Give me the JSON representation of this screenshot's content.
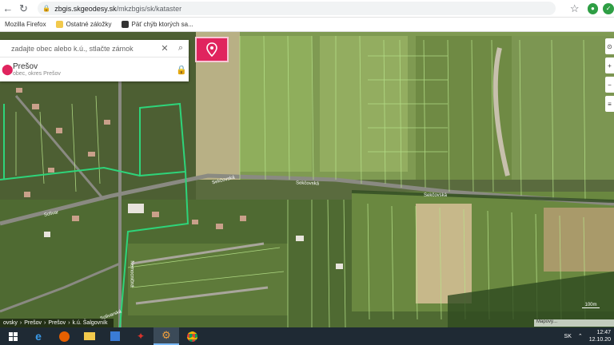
{
  "browser": {
    "back_icon": "arrow-left-icon",
    "refresh_icon": "refresh-icon",
    "url_domain": "zbgis.skgeodesy.sk",
    "url_path": "/mkzbgis/sk/kataster",
    "star_icon": "star-icon"
  },
  "bookmarks": [
    {
      "label": "Mozilla Firefox"
    },
    {
      "label": "Ostatné záložky"
    },
    {
      "label": "Päť chýb ktorých sa..."
    }
  ],
  "search": {
    "placeholder": "zadajte obec alebo k.ú., stlačte zámok"
  },
  "location": {
    "name": "Prešov",
    "subtitle": "obec, okres Prešov"
  },
  "breadcrumb": [
    "ovsky",
    "›",
    "Prešov",
    "›",
    "Prešov",
    "›",
    "k.ú. Šalgovník"
  ],
  "map_labels": {
    "street1": "Sekčovská",
    "street2": "Sekčovská",
    "street3": "Sekčovská",
    "street4": "Solivar",
    "street5": "Nemocničná",
    "street6": "Solivarská"
  },
  "scale": "100m",
  "map_attr": "Mapový...",
  "taskbar": {
    "lang": "SK",
    "time": "12:47",
    "date": "12.10.20"
  },
  "colors": {
    "pink": "#e0245e",
    "taskbar": "#1f2a34"
  }
}
